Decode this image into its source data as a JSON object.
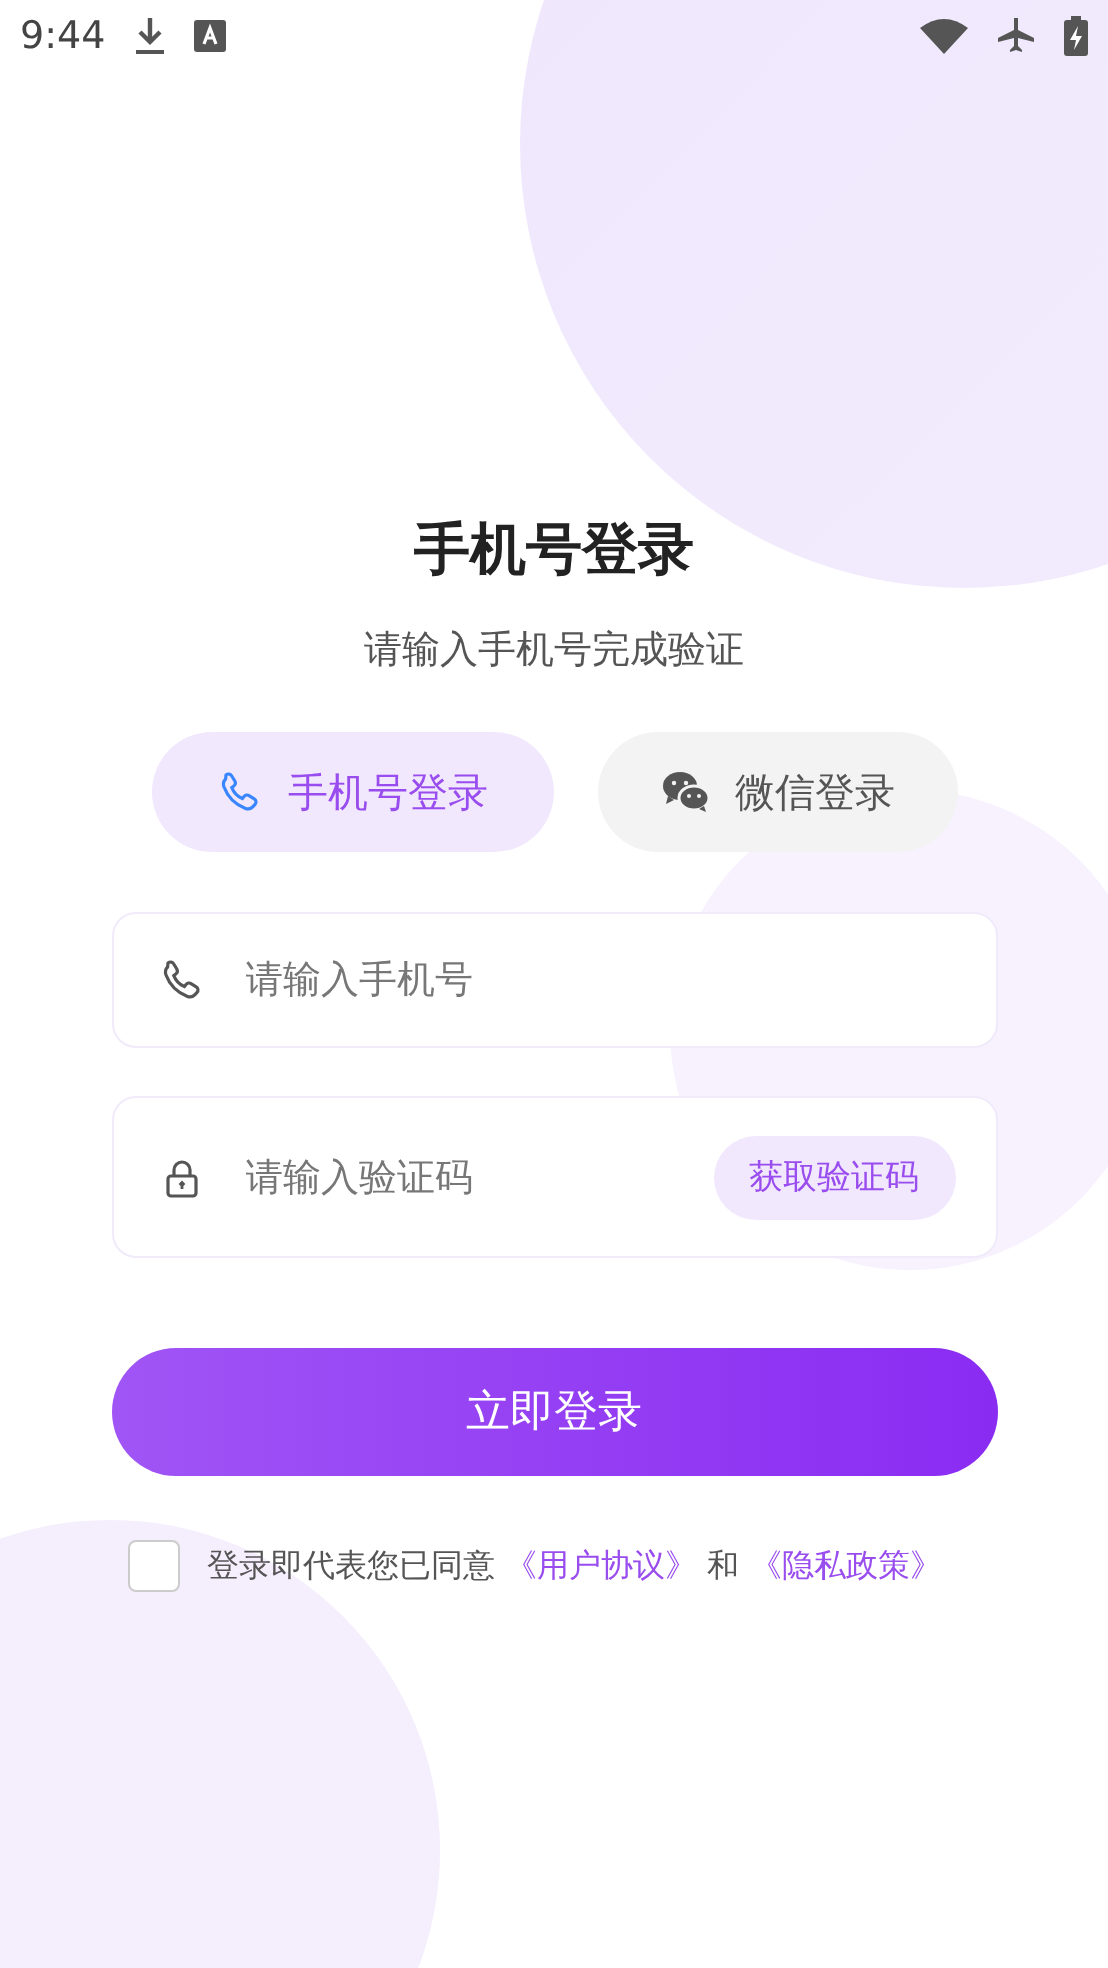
{
  "status_bar": {
    "time": "9:44"
  },
  "title": "手机号登录",
  "subtitle": "请输入手机号完成验证",
  "tabs": [
    {
      "label": "手机号登录",
      "kind": "phone",
      "selected": true
    },
    {
      "label": "微信登录",
      "kind": "wechat",
      "selected": false
    }
  ],
  "fields": [
    {
      "kind": "phone",
      "placeholder": "请输入手机号"
    },
    {
      "kind": "lock",
      "placeholder": "请输入验证码",
      "action": "获取验证码"
    }
  ],
  "submit": "立即登录",
  "agreement": {
    "checked": false,
    "parts": [
      {
        "kind": "text",
        "text": "登录即代表您已同意 "
      },
      {
        "kind": "link",
        "text": "《用户协议》"
      },
      {
        "kind": "text",
        "text": " 和 "
      },
      {
        "kind": "link",
        "text": "《隐私政策》"
      }
    ]
  }
}
